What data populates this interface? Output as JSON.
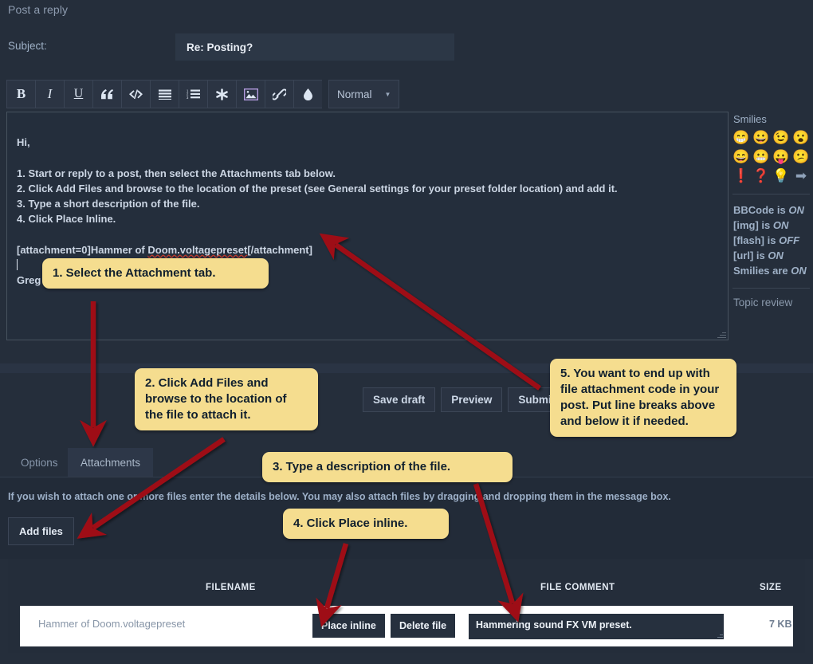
{
  "page": {
    "title": "Post a reply",
    "subject_label": "Subject:",
    "subject_value": "Re: Posting?"
  },
  "toolbar": {
    "buttons": [
      {
        "name": "bold",
        "glyph": "B"
      },
      {
        "name": "italic",
        "glyph": "I"
      },
      {
        "name": "underline",
        "glyph": "U"
      },
      {
        "name": "quote",
        "glyph": "“"
      },
      {
        "name": "code",
        "glyph": "</>"
      },
      {
        "name": "unordered-list",
        "glyph": "☰"
      },
      {
        "name": "ordered-list",
        "glyph": "☷"
      },
      {
        "name": "list-item",
        "glyph": "✳"
      },
      {
        "name": "image",
        "glyph": "ὛC"
      },
      {
        "name": "link",
        "glyph": "ὑ7"
      },
      {
        "name": "font-color",
        "glyph": "Ὂ7"
      }
    ],
    "font_size_label": "Normal",
    "caret": "▼"
  },
  "editor": {
    "lines": [
      "Hi,",
      "",
      "1. Start or reply to a post, then select the Attachments tab below.",
      "2. Click Add Files and browse to the location of the preset (see General settings for your preset folder location) and add it.",
      "3. Type a short description of the file.",
      "4. Click Place Inline.",
      "",
      "[attachment=0]Hammer of Doom.voltagepreset[/attachment]",
      "",
      "Greg"
    ],
    "bbcode_prefix": "[attachment=0]Hammer of ",
    "bbcode_misspelled": "Doom.voltagepreset",
    "bbcode_suffix": "[/attachment]",
    "signature": "Greg"
  },
  "sidebar": {
    "smilies_heading": "Smilies",
    "smilies": [
      {
        "name": "smiley-laugh",
        "glyph": "😁"
      },
      {
        "name": "smiley-grin",
        "glyph": "😀"
      },
      {
        "name": "smiley-wink",
        "glyph": "😉"
      },
      {
        "name": "smiley-surprised",
        "glyph": "😮"
      },
      {
        "name": "smiley-very-happy",
        "glyph": "😄"
      },
      {
        "name": "smiley-grimace",
        "glyph": "😬"
      },
      {
        "name": "smiley-tongue",
        "glyph": "😛"
      },
      {
        "name": "smiley-embarrassed",
        "glyph": "😕"
      },
      {
        "name": "smiley-exclaim",
        "glyph": "❗"
      },
      {
        "name": "smiley-question",
        "glyph": "❓"
      },
      {
        "name": "smiley-idea",
        "glyph": "💡"
      },
      {
        "name": "smiley-arrow",
        "glyph": "➡"
      }
    ],
    "flags": [
      {
        "label": "BBCode is ",
        "value": "ON"
      },
      {
        "label": "[img] is ",
        "value": "ON"
      },
      {
        "label": "[flash] is ",
        "value": "OFF"
      },
      {
        "label": "[url] is ",
        "value": "ON"
      },
      {
        "label": "Smilies are ",
        "value": "ON"
      }
    ],
    "topic_review": "Topic review"
  },
  "actions": {
    "save_draft": "Save draft",
    "preview": "Preview",
    "submit": "Submit"
  },
  "tabs": [
    {
      "name": "options",
      "label": "Options",
      "active": false
    },
    {
      "name": "attachments",
      "label": "Attachments",
      "active": true
    }
  ],
  "attachments": {
    "note": "If you wish to attach one or more files enter the details below. You may also attach files by dragging and dropping them in the message box.",
    "add_files_label": "Add files",
    "columns": {
      "filename": "FILENAME",
      "comment": "FILE COMMENT",
      "size": "SIZE"
    },
    "rows": [
      {
        "filename": "Hammer of Doom.voltagepreset",
        "place_inline": "Place inline",
        "delete_file": "Delete file",
        "comment": "Hammering sound FX VM preset.",
        "size": "7 KB"
      }
    ]
  },
  "callouts": [
    {
      "id": "callout-1",
      "text": "1. Select the Attachment tab."
    },
    {
      "id": "callout-2",
      "text": "2. Click Add Files and browse to the location of the file to attach it."
    },
    {
      "id": "callout-3",
      "text": "3. Type a description of the file."
    },
    {
      "id": "callout-4",
      "text": "4. Click Place inline."
    },
    {
      "id": "callout-5",
      "text": "5. You want to end up with file attachment code in your post. Put line breaks above and below it if needed."
    }
  ],
  "colors": {
    "page_bg": "#252e3b",
    "callout_bg": "#f5dd8f",
    "callout_text": "#11202e",
    "arrow": "#9e1015",
    "accent_text": "#b8c4d4"
  }
}
